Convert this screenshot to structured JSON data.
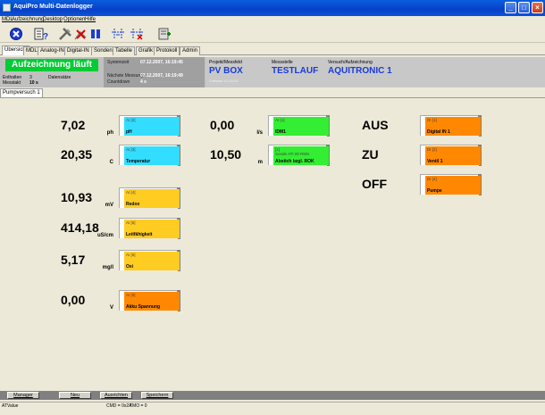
{
  "window": {
    "title": "AquiPro Multi-Datenlogger"
  },
  "menu": [
    "MDL",
    "Aufzeichnung",
    "Desktop",
    "Optionen",
    "Hilfe"
  ],
  "toolbar_icons": [
    "stop-icon",
    "config-icon",
    "tools-icon",
    "pause-icon",
    "channels-icon",
    "delete-channels-icon",
    "export-icon"
  ],
  "tabs": [
    "Übersicht",
    "MDL",
    "Analog-IN",
    "Digital-IN",
    "Sonden",
    "Tabelle",
    "Grafik",
    "Protokoll",
    "Admin"
  ],
  "header": {
    "status": "Aufzeichnung läuft",
    "enthalten_label": "Enthalten",
    "enthalten_value": "3",
    "datensaetze_label": "Datensätze",
    "messtakt_label": "Messtakt",
    "messtakt_value": "10 s",
    "systemzeit_label": "Systemzeit",
    "systemzeit_value": "07.12.2007, 16:19:45",
    "naechste_label": "Nächste Messung",
    "naechste_value": "07.12.2007, 16:19:49",
    "countdown_label": "Countdown",
    "countdown_value": "4 s",
    "projekt_label": "Projekt/Messfeld",
    "projekt_value": "PV BOX",
    "software_label": "Software 01.18.00",
    "messstelle_label": "Messstelle",
    "messstelle_value": "TESTLAUF",
    "versuch_label": "Versuch/Aufzeichnung",
    "versuch_value": "AQUITRONIC 1"
  },
  "subtab": "Pumpversuch 1",
  "measurements": [
    {
      "value": "7,02",
      "unit": "ph",
      "channel": "AI [2]",
      "name": "pH",
      "color": "#33ddff"
    },
    {
      "value": "20,35",
      "unit": "C",
      "channel": "AI [3]",
      "name": "Temperatur",
      "color": "#33ddff"
    },
    {
      "value": "10,93",
      "unit": "mV",
      "channel": "AI [4]",
      "name": "Redox",
      "color": "#ffcc22"
    },
    {
      "value": "414,18",
      "unit": "uS/cm",
      "channel": "AI [5]",
      "name": "Leitfähigkeit",
      "color": "#ffcc22"
    },
    {
      "value": "5,17",
      "unit": "mg/l",
      "channel": "AI [6]",
      "name": "Oxi",
      "color": "#ffcc22"
    },
    {
      "value": "0,00",
      "unit": "V",
      "channel": "AI [8]",
      "name": "Akku Spannung",
      "color": "#ff8800"
    },
    {
      "value": "0,00",
      "unit": "l/s",
      "channel": "AI [1]",
      "name": "IDM1",
      "color": "#33ee33"
    },
    {
      "value": "10,50",
      "unit": "m",
      "channel": "[1]",
      "channel2": "Sonde ATI 00 RMS",
      "name": "Abstich bzgl. ROK",
      "color": "#33ee33"
    },
    {
      "value": "AUS",
      "unit": "",
      "channel": "DI [1]",
      "name": "Digital IN 1",
      "color": "#ff8800"
    },
    {
      "value": "ZU",
      "unit": "",
      "channel": "DI [2]",
      "name": "Ventil 1",
      "color": "#ff8800"
    },
    {
      "value": "OFF",
      "unit": "",
      "channel": "DI [4]",
      "name": "Pumpe",
      "color": "#ff8800"
    }
  ],
  "bottom_buttons": [
    "Manager",
    "Neu",
    "Ausrichten",
    "Speichern"
  ],
  "statusbar": {
    "left": "ATValue",
    "cmd": "CMD = 0x2A",
    "tmo": "TMO = 0"
  }
}
